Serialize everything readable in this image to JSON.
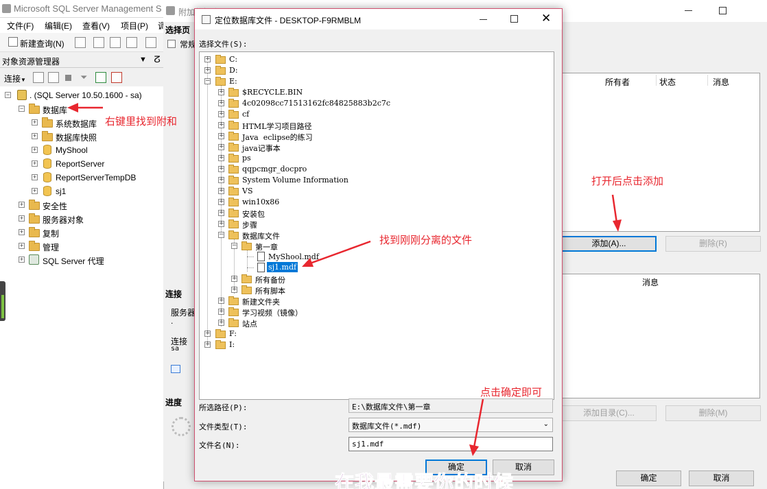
{
  "ssms": {
    "title": "Microsoft SQL Server Management S",
    "menu": [
      "文件(F)",
      "编辑(E)",
      "查看(V)",
      "项目(P)",
      "调"
    ],
    "toolbar_new_query": "新建查询(N)",
    "object_explorer_title": "对象资源管理器",
    "connect_label": "连接",
    "tree": {
      "server": ". (SQL Server 10.50.1600 - sa)",
      "databases": "数据库",
      "db_children": [
        "系统数据库",
        "数据库快照",
        "MyShool",
        "ReportServer",
        "ReportServerTempDB",
        "sj1"
      ],
      "other_nodes": [
        "安全性",
        "服务器对象",
        "复制",
        "管理",
        "SQL Server 代理"
      ]
    }
  },
  "wizard": {
    "title": "附加数据库",
    "select_page": "选择页",
    "page_general": "常规",
    "columns_top": [
      "所有者",
      "状态",
      "消息"
    ],
    "columns_bottom": [
      "消息"
    ],
    "add_button": "添加(A)...",
    "remove_button_top": "删除(R)",
    "add_catalog_button": "添加目录(C)...",
    "remove_button_bottom": "删除(M)",
    "connection_section": "连接",
    "server_label": "服务器",
    "server_value": ".",
    "connection_label": "连接",
    "connection_value": "sa",
    "progress_section": "进度",
    "ok_button": "确定",
    "cancel_button": "取消"
  },
  "dialog": {
    "title": "定位数据库文件 - DESKTOP-F9RMBLM",
    "select_file_label": "选择文件(S):",
    "drives": [
      "C:",
      "D:",
      "E:",
      "F:",
      "I:"
    ],
    "e_children": [
      "$RECYCLE.BIN",
      "4c02098cc71513162fc84825883b2c7c",
      "cf",
      "HTML学习项目路径",
      "Java  eclipse的练习",
      "java记事本",
      "ps",
      "qqpcmgr_docpro",
      "System Volume Information",
      "VS",
      "win10x86",
      "安装包",
      "步骤",
      "数据库文件"
    ],
    "db_folder_children": [
      "第一章"
    ],
    "chapter_files": [
      "MyShool.mdf",
      "sj1.mdf"
    ],
    "db_folder_after": [
      "所有备份",
      "所有脚本"
    ],
    "e_children_after": [
      "新建文件夹",
      "学习视频（镜像）",
      "站点"
    ],
    "selected_path_label": "所选路径(P):",
    "selected_path_value": "E:\\数据库文件\\第一章",
    "file_type_label": "文件类型(T):",
    "file_type_value": "数据库文件(*.mdf)",
    "file_name_label": "文件名(N):",
    "file_name_value": "sj1.mdf",
    "ok_button": "确定",
    "cancel_button": "取消"
  },
  "annotations": {
    "right_click": "右键里找到附和",
    "click_add": "打开后点击添加",
    "find_file": "找到刚刚分离的文件",
    "click_ok": "点击确定即可",
    "bottom_text": "在我最需要你的时候"
  },
  "colors": {
    "annotation_red": "#e8272f",
    "selection_blue": "#0078d7",
    "dialog_border": "#d04f6e",
    "bottom_text_purple": "#8a2a9a"
  }
}
